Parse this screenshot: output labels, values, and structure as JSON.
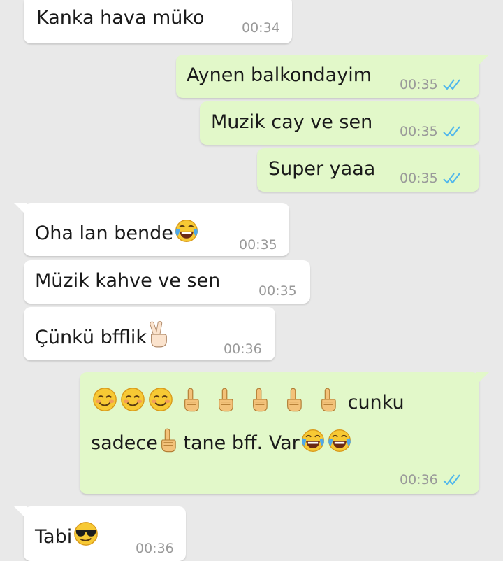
{
  "messages": [
    {
      "id": "m1",
      "direction": "incoming",
      "text": "Kanka hava müko",
      "time": "00:34"
    },
    {
      "id": "m2",
      "direction": "outgoing",
      "text": "Aynen balkondayim",
      "time": "00:35",
      "status": "read"
    },
    {
      "id": "m3",
      "direction": "outgoing",
      "text": "Muzik cay ve sen",
      "time": "00:35",
      "status": "read"
    },
    {
      "id": "m4",
      "direction": "outgoing",
      "text": "Super yaaa",
      "time": "00:35",
      "status": "read"
    },
    {
      "id": "m5",
      "direction": "incoming",
      "text": "Oha lan bende",
      "emoji_after": "tears-of-joy",
      "time": "00:35"
    },
    {
      "id": "m6",
      "direction": "incoming",
      "text": "Müzik kahve ve sen",
      "time": "00:35"
    },
    {
      "id": "m7",
      "direction": "incoming",
      "text": "Çünkü bfflik",
      "emoji_after": "victory-hand",
      "time": "00:36"
    },
    {
      "id": "m8",
      "direction": "outgoing",
      "emoji_prefix": [
        "smiling-face",
        "smiling-face",
        "smiling-face",
        "index-pointing-up",
        "index-pointing-up",
        "index-pointing-up",
        "index-pointing-up",
        "index-pointing-up"
      ],
      "text_a": "cunku",
      "text_b": "sadece",
      "emoji_mid": "index-pointing-up",
      "text_c": "tane bff. Var",
      "emoji_suffix": [
        "tears-of-joy",
        "tears-of-joy"
      ],
      "time": "00:36",
      "status": "read"
    },
    {
      "id": "m9",
      "direction": "incoming",
      "text": "Tabi",
      "emoji_after": "smiling-face-with-sunglasses",
      "time": "00:36"
    }
  ],
  "colors": {
    "background": "#e9e9e9",
    "incoming_bubble": "#ffffff",
    "outgoing_bubble": "#e2f8c9",
    "read_ticks": "#4fb6ec",
    "timestamp": "#9a9a9a"
  }
}
